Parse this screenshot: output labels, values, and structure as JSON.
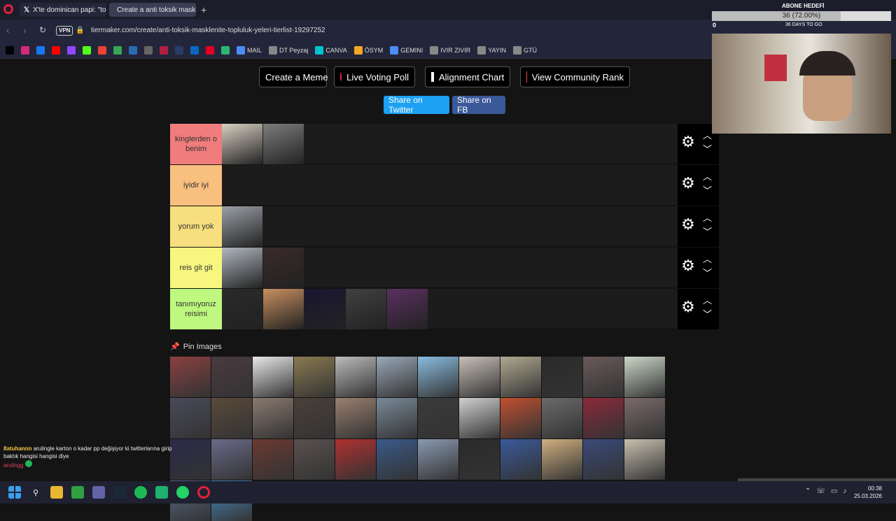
{
  "browser": {
    "tabs": [
      {
        "label": "X'te dominican papi: \"topl",
        "icon": "x-icon"
      },
      {
        "label": "Create a anti toksik maskl",
        "icon": "tiermaker-icon"
      }
    ],
    "vpn_label": "VPN",
    "url": "tiermaker.com/create/anti-toksik-masklenite-topluluk-yeleri-tierlist-19297252",
    "bookmarks": [
      {
        "label": "",
        "icon": "x-icon",
        "color": "#000000"
      },
      {
        "label": "",
        "icon": "instagram-icon",
        "color": "#d6297a"
      },
      {
        "label": "",
        "icon": "facebook-icon",
        "color": "#1877f2"
      },
      {
        "label": "",
        "icon": "youtube-icon",
        "color": "#ff0000"
      },
      {
        "label": "",
        "icon": "twitch-icon",
        "color": "#9146ff"
      },
      {
        "label": "",
        "icon": "kick-icon",
        "color": "#53fc18"
      },
      {
        "label": "",
        "icon": "gmail-icon",
        "color": "#ea4335"
      },
      {
        "label": "",
        "icon": "maps-icon",
        "color": "#34a853"
      },
      {
        "label": "",
        "icon": "dollar-icon",
        "color": "#2b6cb0"
      },
      {
        "label": "",
        "icon": "link-icon",
        "color": "#666666"
      },
      {
        "label": "",
        "icon": "bookmark-icon",
        "color": "#b02040"
      },
      {
        "label": "",
        "icon": "square-icon",
        "color": "#2a3b66"
      },
      {
        "label": "",
        "icon": "linkedin-icon",
        "color": "#0a66c2"
      },
      {
        "label": "",
        "icon": "pinterest-icon",
        "color": "#e60023"
      },
      {
        "label": "",
        "icon": "phone-icon",
        "color": "#2bb673"
      },
      {
        "label": "MAIL",
        "icon": "mail-icon",
        "color": "#4a8ef5"
      },
      {
        "label": "DT Peyzaj",
        "icon": "page-icon",
        "color": "#888888"
      },
      {
        "label": "CANVA",
        "icon": "canva-icon",
        "color": "#00c4cc"
      },
      {
        "label": "ÖSYM",
        "icon": "osym-icon",
        "color": "#f5a623"
      },
      {
        "label": "GEMINI",
        "icon": "gemini-icon",
        "color": "#4a8ef5"
      },
      {
        "label": "IVIR ZIVIR",
        "icon": "folder-icon",
        "color": "#888888"
      },
      {
        "label": "YAYIN",
        "icon": "folder-icon",
        "color": "#888888"
      },
      {
        "label": "GTÜ",
        "icon": "folder-icon",
        "color": "#888888"
      }
    ]
  },
  "actions": {
    "create_meme": "Create a Meme",
    "live_voting": "Live Voting Poll",
    "alignment_chart": "Alignment Chart",
    "community_rank": "View Community Rank",
    "share_twitter": "Share on Twitter",
    "share_fb": "Share on FB"
  },
  "tiers": [
    {
      "label": "kinglerden o benim",
      "color": "#f07c7c",
      "images": [
        "#d8cfc2",
        "#7c7c7c"
      ]
    },
    {
      "label": "iyidir iyi",
      "color": "#f8bf7f",
      "images": []
    },
    {
      "label": "yorum yok",
      "color": "#f7de7e",
      "images": [
        "#9aa0a6"
      ]
    },
    {
      "label": "reis git git",
      "color": "#f7f77f",
      "images": [
        "#b0b8c0",
        "#3a2a2a"
      ]
    },
    {
      "label": "tanımıyoruz reisimi",
      "color": "#bef87f",
      "images": [
        "#2a2a2a",
        "#c89060",
        "#1a1530",
        "#404040",
        "#5a3060"
      ]
    }
  ],
  "pin_images_label": "Pin Images",
  "pool_colors": [
    "#8a4040",
    "#4a3a40",
    "#e8e8e8",
    "#8a7a50",
    "#bbbbbb",
    "#9aa8b8",
    "#8abce0",
    "#c8c0b8",
    "#b0a890",
    "#2a2a2a",
    "#6a5a5a",
    "#ccd8c8",
    "#4a4a5a",
    "#5a4a3a",
    "#8a7a70",
    "#4a4038",
    "#9a8070",
    "#7a8a9a",
    "#3a3a3a",
    "#d0d0d0",
    "#c05030",
    "#6a6a6a",
    "#8a2a3a",
    "#7a6a6a",
    "#2a2a4a",
    "#6a6a8a",
    "#6a3a30",
    "#5a5050",
    "#b03030",
    "#3a5a8a",
    "#8a9ab0",
    "#2a2a2a",
    "#3a5a9a",
    "#d0b080",
    "#3a4a7a",
    "#c8c0b0",
    "#5a6a8a",
    "#4a90c8"
  ],
  "overlay": {
    "goal_title": "ABONE HEDEFİ",
    "goal_progress": "36 (72.00%)",
    "goal_fraction": 0.72,
    "goal_min": "0",
    "days_text": "36 DAYS TO GO"
  },
  "chat": {
    "user": "8atuhannn",
    "message": "arulingle karton o kadar pp değişiyor ki twitterlarına girip baktık hangisi hangisi diye",
    "user2": "arulingg"
  },
  "taskbar": {
    "time": "00:38",
    "date": "25.03.2026"
  }
}
